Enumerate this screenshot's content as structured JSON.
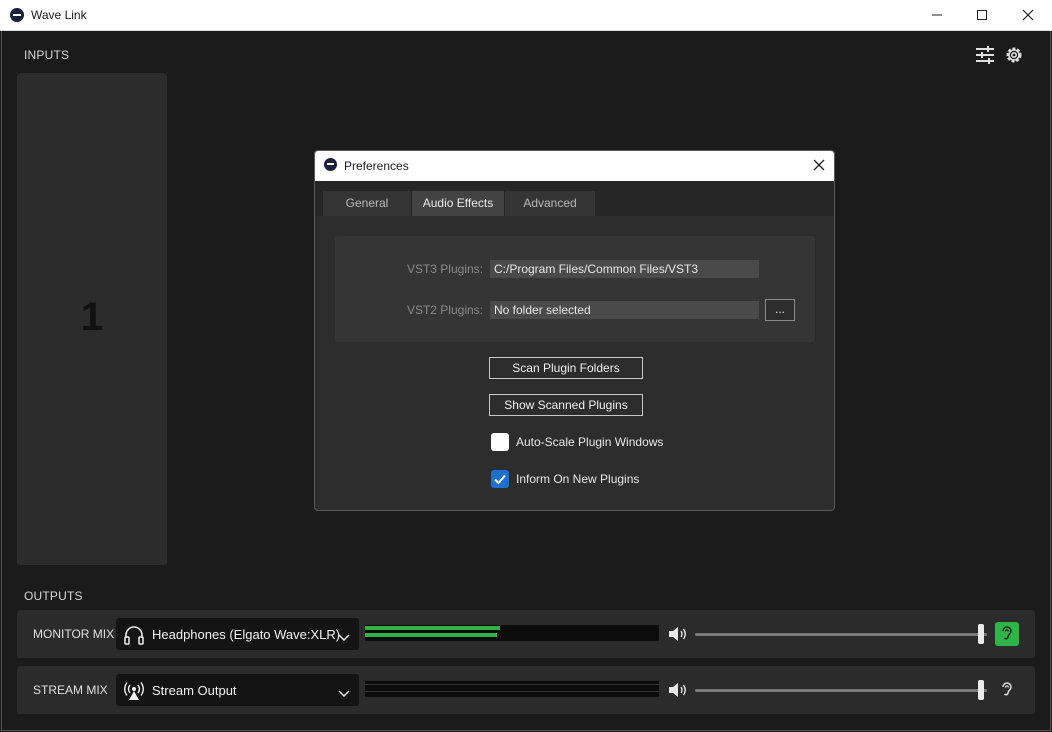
{
  "window": {
    "title": "Wave Link",
    "minimize_glyph": "—",
    "icons": [
      "wave-link-app-icon",
      "minimize-icon",
      "maximize-icon",
      "close-icon"
    ]
  },
  "inputs": {
    "label": "INPUTS",
    "channel_number": "1"
  },
  "toolbar_icons": [
    "mixer-settings-icon",
    "gear-icon"
  ],
  "outputs": {
    "label": "OUTPUTS",
    "rows": [
      {
        "label": "MONITOR MIX",
        "device": "Headphones (Elgato Wave:XLR)",
        "device_icon": "headphones-icon",
        "meter_level": 0.46,
        "volume": 0.98,
        "listen_active": true
      },
      {
        "label": "STREAM MIX",
        "device": "Stream Output",
        "device_icon": "broadcast-icon",
        "meter_level": 0.0,
        "volume": 0.98,
        "listen_active": false
      }
    ]
  },
  "dialog": {
    "title": "Preferences",
    "tabs": [
      "General",
      "Audio Effects",
      "Advanced"
    ],
    "active_tab": "Audio Effects",
    "vst3_label": "VST3 Plugins:",
    "vst3_value": "C:/Program Files/Common Files/VST3",
    "vst2_label": "VST2 Plugins:",
    "vst2_value": "No folder selected",
    "browse_label": "...",
    "scan_button": "Scan Plugin Folders",
    "show_button": "Show Scanned Plugins",
    "auto_scale_label": "Auto-Scale Plugin Windows",
    "auto_scale_checked": false,
    "inform_label": "Inform On New Plugins",
    "inform_checked": true
  },
  "colors": {
    "accent_green": "#2fb44a",
    "checkbox_blue": "#1d6fd0",
    "background": "#1b1b1b"
  }
}
